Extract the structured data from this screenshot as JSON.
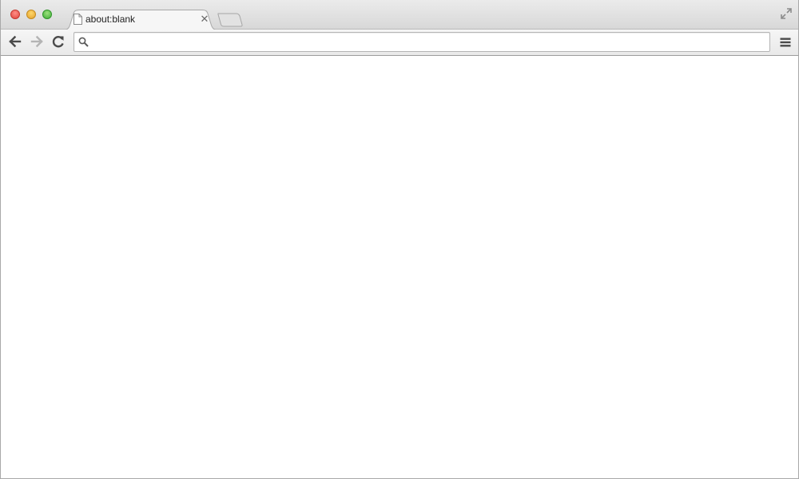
{
  "tab": {
    "title": "about:blank",
    "close_glyph": "✕"
  },
  "toolbar": {
    "omnibox": {
      "value": "",
      "placeholder": ""
    }
  },
  "icons": {
    "traffic_close": "window-close-icon",
    "traffic_minimize": "window-minimize-icon",
    "traffic_zoom": "window-zoom-icon",
    "page": "page-icon",
    "new_tab": "new-tab-icon",
    "fullscreen": "fullscreen-icon",
    "back": "back-arrow-icon",
    "forward": "forward-arrow-icon",
    "reload": "reload-icon",
    "search": "search-icon",
    "menu": "hamburger-menu-icon"
  },
  "colors": {
    "traffic_close": "#e0443e",
    "traffic_minimize": "#e3a12c",
    "traffic_zoom": "#3fae36",
    "forward_disabled": "#b4b4b4",
    "icon_dark": "#4a4a4a"
  }
}
